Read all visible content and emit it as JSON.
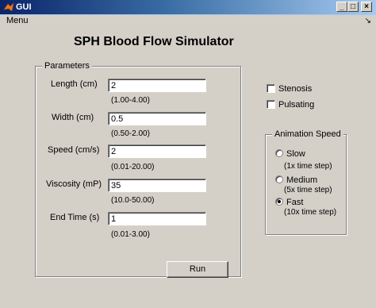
{
  "window": {
    "title": "GUI",
    "minimize": "_",
    "maximize": "□",
    "close": "×"
  },
  "menu": {
    "label": "Menu",
    "arrow": "↘"
  },
  "app_title": "SPH Blood Flow Simulator",
  "parameters": {
    "legend": "Parameters",
    "fields": [
      {
        "label": "Length (cm)",
        "value": "2",
        "range": "(1.00-4.00)"
      },
      {
        "label": "Width (cm)",
        "value": "0.5",
        "range": "(0.50-2.00)"
      },
      {
        "label": "Speed (cm/s)",
        "value": "2",
        "range": "(0.01-20.00)"
      },
      {
        "label": "Viscosity (mP)",
        "value": "35",
        "range": "(10.0-50.00)"
      },
      {
        "label": "End Time (s)",
        "value": "1",
        "range": "(0.01-3.00)"
      }
    ]
  },
  "options": {
    "stenosis": {
      "label": "Stenosis",
      "checked": false
    },
    "pulsating": {
      "label": "Pulsating",
      "checked": false
    }
  },
  "animation_speed": {
    "legend": "Animation Speed",
    "options": [
      {
        "label": "Slow",
        "sub": "(1x time step)",
        "selected": false
      },
      {
        "label": "Medium",
        "sub": "(5x time step)",
        "selected": false
      },
      {
        "label": "Fast",
        "sub": "(10x time step)",
        "selected": true
      }
    ]
  },
  "run_button": "Run"
}
